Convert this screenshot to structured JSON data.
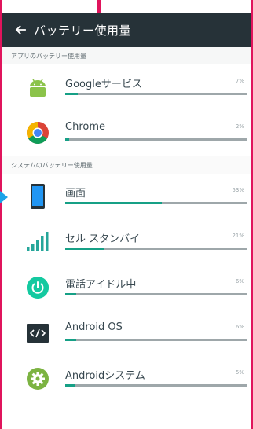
{
  "appbar": {
    "title": "バッテリー使用量",
    "back_icon": "arrow-back-icon"
  },
  "sections": [
    {
      "title": "アプリのバッテリー使用量",
      "items": [
        {
          "icon": "android-robot-icon",
          "label": "Googleサービス",
          "percent_text": "7%",
          "percent": 7
        },
        {
          "icon": "chrome-icon",
          "label": "Chrome",
          "percent_text": "2%",
          "percent": 2
        }
      ]
    },
    {
      "title": "システムのバッテリー使用量",
      "items": [
        {
          "icon": "phone-screen-icon",
          "label": "画面",
          "percent_text": "53%",
          "percent": 53
        },
        {
          "icon": "signal-bars-icon",
          "label": "セル スタンバイ",
          "percent_text": "21%",
          "percent": 21
        },
        {
          "icon": "power-icon",
          "label": "電話アイドル中",
          "percent_text": "6%",
          "percent": 6
        },
        {
          "icon": "code-icon",
          "label": "Android OS",
          "percent_text": "6%",
          "percent": 6
        },
        {
          "icon": "android-settings-icon",
          "label": "Androidシステム",
          "percent_text": "5%",
          "percent": 5
        }
      ]
    }
  ],
  "colors": {
    "appbar": "#263238",
    "bar_fill": "#16a086",
    "bar_track": "#9ea7aa",
    "frame": "#e0145c"
  }
}
